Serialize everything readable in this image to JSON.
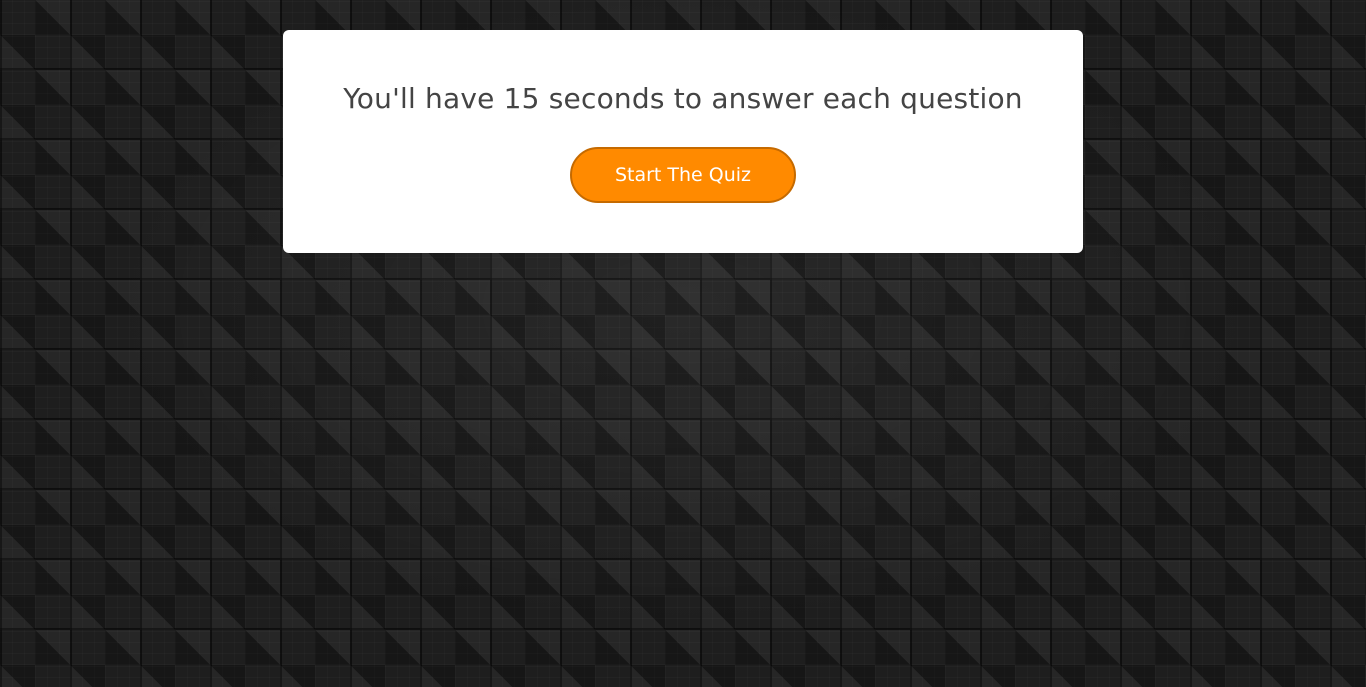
{
  "start_box": {
    "message": "You'll have 15 seconds to answer each question",
    "start_button_label": "Start The Quiz"
  },
  "colors": {
    "accent": "#ff8a00",
    "accent_border": "#c56a00",
    "card_background": "#ffffff",
    "text": "#444444",
    "page_background": "#1e1e1e"
  }
}
